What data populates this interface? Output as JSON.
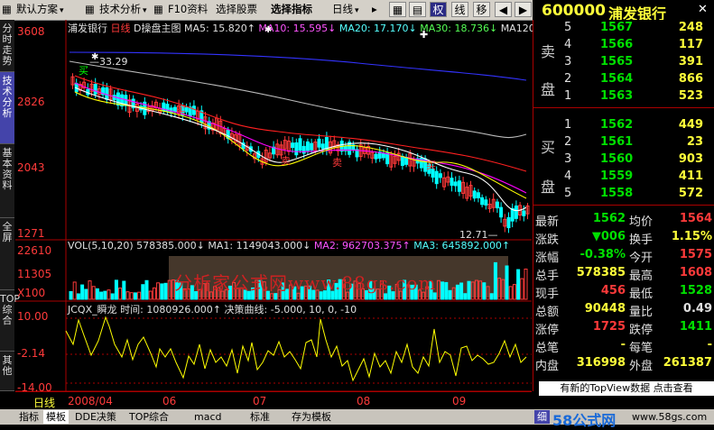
{
  "toolbar": {
    "items": [
      "默认方案",
      "技术分析",
      "F10资料",
      "选择股票",
      "选择指标",
      "日线"
    ],
    "buttons": [
      "权",
      "线",
      "移"
    ],
    "stock_code": "600000",
    "stock_name": "浦发银行"
  },
  "left_tabs": [
    "分时走势",
    "技术分析",
    "基本资料",
    "全屏",
    "TOP综合",
    "其他"
  ],
  "main_chart": {
    "title": "浦发银行",
    "period": "日线",
    "indicator": "D操盘主图",
    "ma5": "MA5: 15.820↑",
    "ma10": "MA10: 15.595↓",
    "ma20": "MA20: 17.170↓",
    "ma30": "MA30: 18.736↓",
    "ma120": "MA120",
    "y_ticks": [
      "3608",
      "2826",
      "2043",
      "1271"
    ],
    "high_label": "33.29",
    "low_label": "12.71",
    "buy_tag": "买",
    "sell_tag": "卖"
  },
  "vol_chart": {
    "vol_label": "VOL(5,10,20) 578385.000↓",
    "ma1": "MA1: 1149043.000↓",
    "ma2": "MA2: 962703.375↑",
    "ma3": "MA3: 645892.000↑",
    "y_ticks": [
      "22610",
      "11305",
      "X100"
    ],
    "watermark": "分析家公式网www.88gs.com"
  },
  "ind_chart": {
    "label": "JCQX_瞬龙",
    "time": "时间: 1080926.000↑",
    "decision": "决策曲线: -5.000, 10, 0, -10",
    "y_ticks": [
      "10.00",
      "-2.14",
      "-14.00"
    ]
  },
  "x_axis": {
    "period_label": "日线",
    "dates": [
      "2008/04",
      "06",
      "07",
      "08",
      "09"
    ]
  },
  "order_book": {
    "sell_label": [
      "卖",
      "盘"
    ],
    "buy_label": [
      "买",
      "盘"
    ],
    "sells": [
      {
        "lvl": "5",
        "price": "1567",
        "vol": "248"
      },
      {
        "lvl": "4",
        "price": "1566",
        "vol": "117"
      },
      {
        "lvl": "3",
        "price": "1565",
        "vol": "391"
      },
      {
        "lvl": "2",
        "price": "1564",
        "vol": "866"
      },
      {
        "lvl": "1",
        "price": "1563",
        "vol": "523"
      }
    ],
    "buys": [
      {
        "lvl": "1",
        "price": "1562",
        "vol": "449"
      },
      {
        "lvl": "2",
        "price": "1561",
        "vol": "23"
      },
      {
        "lvl": "3",
        "price": "1560",
        "vol": "903"
      },
      {
        "lvl": "4",
        "price": "1559",
        "vol": "411"
      },
      {
        "lvl": "5",
        "price": "1558",
        "vol": "572"
      }
    ]
  },
  "quote": [
    {
      "k1": "最新",
      "v1": "1562",
      "k2": "均价",
      "v2": "1564"
    },
    {
      "k1": "涨跌",
      "v1": "▼006",
      "k2": "换手",
      "v2": "1.15%"
    },
    {
      "k1": "涨幅",
      "v1": "-0.38%",
      "k2": "今开",
      "v2": "1575"
    },
    {
      "k1": "总手",
      "v1": "578385",
      "k2": "最高",
      "v2": "1608"
    },
    {
      "k1": "现手",
      "v1": "456",
      "k2": "最低",
      "v2": "1528"
    },
    {
      "k1": "总额",
      "v1": "90448",
      "k2": "量比",
      "v2": "0.49"
    },
    {
      "k1": "涨停",
      "v1": "1725",
      "k2": "跌停",
      "v2": "1411"
    },
    {
      "k1": "总笔",
      "v1": "-",
      "k2": "每笔",
      "v2": "-"
    },
    {
      "k1": "内盘",
      "v1": "316998",
      "k2": "外盘",
      "v2": "261387"
    }
  ],
  "banner": "有新的TopView数据 点击查看",
  "footer_logo": "58公式网",
  "footer_url": "www.58gs.com",
  "footer_tab": "细",
  "bottom_tabs": [
    "指标",
    "模板",
    "DDE决策",
    "TOP综合",
    "macd",
    "标准",
    "存为模板"
  ],
  "colors": {
    "up": "#ff3a3a",
    "down": "#00e000",
    "ma5": "#ffffff",
    "ma10": "#ffff00",
    "ma20": "#ff00ff",
    "ma30": "#00ff00",
    "ma120": "#3333ff",
    "accent": "#ffff3a"
  }
}
